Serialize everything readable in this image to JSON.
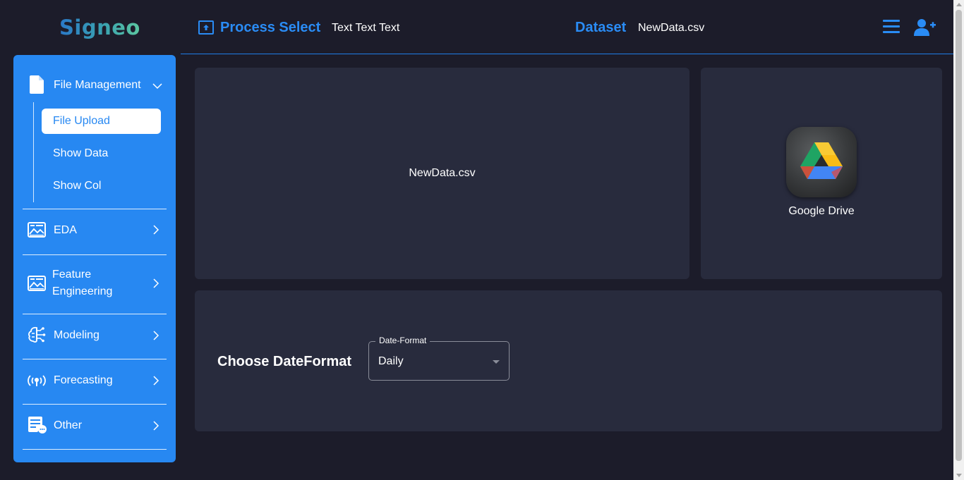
{
  "logo": {
    "text": "Signeo"
  },
  "header": {
    "process_title": "Process Select",
    "process_sub": "Text Text Text",
    "dataset_label": "Dataset",
    "dataset_file": "NewData.csv",
    "menu_icon": "hamburger-menu-icon",
    "user_icon": "user-add-icon"
  },
  "sidebar": {
    "items": [
      {
        "label": "File Management",
        "icon": "file-icon",
        "expanded": true
      },
      {
        "label": "EDA",
        "icon": "chart-image-icon"
      },
      {
        "label": "Feature",
        "label2": "Engineering",
        "icon": "chart-image-icon"
      },
      {
        "label": "Modeling",
        "icon": "brain-circuit-icon"
      },
      {
        "label": "Forecasting",
        "icon": "broadcast-icon"
      },
      {
        "label": "Other",
        "icon": "document-chat-icon"
      }
    ],
    "subitems": [
      {
        "label": "File Upload",
        "active": true
      },
      {
        "label": "Show Data"
      },
      {
        "label": "Show Col"
      }
    ]
  },
  "main": {
    "file_card": {
      "filename": "NewData.csv"
    },
    "drive_card": {
      "label": "Google Drive"
    },
    "date_card": {
      "title": "Choose DateFormat",
      "select_legend": "Date-Format",
      "select_value": "Daily"
    }
  },
  "colors": {
    "accent": "#2788f2",
    "background": "#1c1c2a",
    "card": "#282b3d"
  }
}
